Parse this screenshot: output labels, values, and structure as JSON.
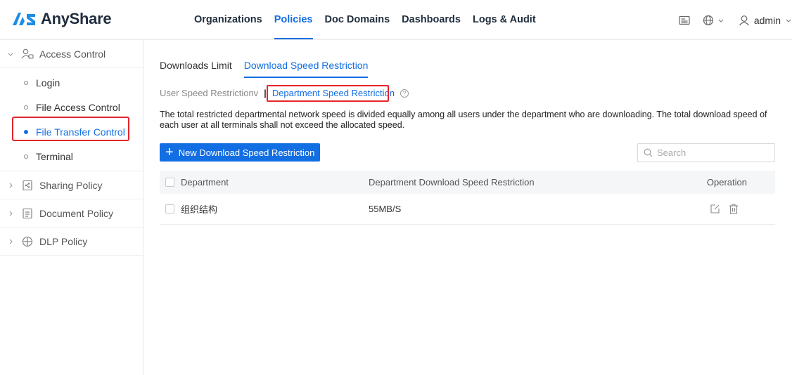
{
  "header": {
    "brand": "AnyShare",
    "nav": [
      "Organizations",
      "Policies",
      "Doc Domains",
      "Dashboards",
      "Logs & Audit"
    ],
    "active_nav_index": 1,
    "user": "admin",
    "accent_color": "#126ee3"
  },
  "sidebar": {
    "groups": [
      {
        "label": "Access Control",
        "expanded": true,
        "icon": "user-shield-icon",
        "items": [
          {
            "label": "Login"
          },
          {
            "label": "File Access Control"
          },
          {
            "label": "File Transfer Control",
            "active": true
          },
          {
            "label": "Terminal"
          }
        ]
      },
      {
        "label": "Sharing Policy",
        "expanded": false,
        "icon": "share-doc-icon"
      },
      {
        "label": "Document Policy",
        "expanded": false,
        "icon": "document-icon"
      },
      {
        "label": "DLP Policy",
        "expanded": false,
        "icon": "dlp-shield-icon"
      }
    ]
  },
  "main": {
    "tabs": [
      "Downloads Limit",
      "Download Speed Restriction"
    ],
    "active_tab_index": 1,
    "subtabs": [
      "User Speed Restrictionv",
      "Department Speed Restriction"
    ],
    "active_subtab_index": 1,
    "description": "The total restricted departmental network speed is divided equally among all users under the department who are downloading. The total download speed of each user at all terminals shall not exceed the allocated speed.",
    "new_button": "New Download Speed Restriction",
    "search_placeholder": "Search",
    "table": {
      "columns": [
        "Department",
        "Department Download Speed Restriction",
        "Operation"
      ],
      "rows": [
        {
          "department": "组织结构",
          "speed": "55MB/S"
        }
      ]
    }
  },
  "highlight_color": "#e3262b"
}
